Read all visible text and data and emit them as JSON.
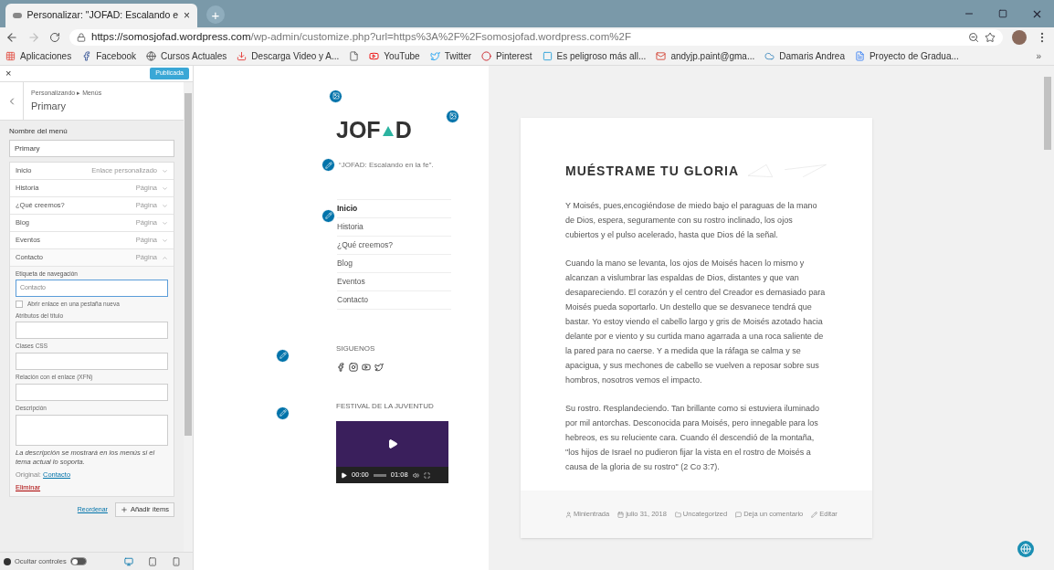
{
  "browser": {
    "tab": {
      "title": "Personalizar: \"JOFAD: Escalando e",
      "close": "×",
      "new_tab": "+"
    },
    "url": {
      "host": "https://somosjofad.wordpress.com",
      "path": "/wp-admin/customize.php?url=https%3A%2F%2Fsomosjofad.wordpress.com%2F"
    },
    "bookmarks": [
      {
        "kind": "apps",
        "label": "Aplicaciones"
      },
      {
        "kind": "facebook",
        "label": "Facebook"
      },
      {
        "kind": "globe",
        "label": "Cursos Actuales"
      },
      {
        "kind": "download",
        "label": "Descarga Video y A..."
      },
      {
        "kind": "page"
      },
      {
        "kind": "youtube",
        "label": "YouTube"
      },
      {
        "kind": "twitter",
        "label": "Twitter"
      },
      {
        "kind": "pinterest",
        "label": "Pinterest"
      },
      {
        "kind": "k",
        "label": "Es peligroso más all..."
      },
      {
        "kind": "gmail",
        "label": "andyjp.paint@gma..."
      },
      {
        "kind": "cloud",
        "label": "Damaris Andrea"
      },
      {
        "kind": "doc",
        "label": "Proyecto de Gradua..."
      }
    ],
    "more": "»"
  },
  "customizer": {
    "close": "×",
    "publish": "Publicada",
    "breadcrumb": "Personalizando ▸ Menús",
    "title": "Primary",
    "menu_name_label": "Nombre del menú",
    "menu_name": "Primary",
    "items": [
      {
        "label": "Inicio",
        "type": "Enlace personalizado",
        "expanded": false
      },
      {
        "label": "Historia",
        "type": "Página",
        "expanded": false
      },
      {
        "label": "¿Qué creemos?",
        "type": "Página",
        "expanded": false
      },
      {
        "label": "Blog",
        "type": "Página",
        "expanded": false
      },
      {
        "label": "Eventos",
        "type": "Página",
        "expanded": false
      },
      {
        "label": "Contacto",
        "type": "Página",
        "expanded": true
      }
    ],
    "nav_label": "Etiqueta de navegación",
    "nav_value": "Contacto",
    "new_tab": {
      "label": "Abrir enlace en una pestaña nueva",
      "checked": false
    },
    "fields": [
      {
        "label": "Atributos del título",
        "kind": "input"
      },
      {
        "label": "Clases CSS",
        "kind": "input"
      },
      {
        "label": "Relación con el enlace (XFN)",
        "kind": "input"
      },
      {
        "label": "Descripción",
        "kind": "textarea"
      }
    ],
    "note": "La descripción se mostrará en los menús si el tema actual lo soporta.",
    "original_label": "Original:",
    "original_link": "Contacto",
    "remove": "Eliminar",
    "reorder": "Reordenar",
    "add": "Añadir ítems",
    "hide_controls": {
      "label": "Ocultar controles",
      "on": false
    },
    "devices": [
      {
        "kind": "desktop",
        "selected": true
      },
      {
        "kind": "tablet",
        "selected": false
      },
      {
        "kind": "mobile",
        "selected": false
      }
    ]
  },
  "preview": {
    "logo": {
      "before": "JOF",
      "after": "D"
    },
    "tagline": "“JOFAD: Escalando en la fe”.",
    "nav": [
      {
        "label": "Inicio",
        "selected": true
      },
      {
        "label": "Historia",
        "selected": false
      },
      {
        "label": "¿Qué creemos?",
        "selected": false
      },
      {
        "label": "Blog",
        "selected": false
      },
      {
        "label": "Eventos",
        "selected": false
      },
      {
        "label": "Contacto",
        "selected": false
      }
    ],
    "follow_title": "SIGUENOS",
    "video_title": "FESTIVAL DE LA JUVENTUD",
    "video": {
      "start": "00:00",
      "end": "01:08"
    },
    "post": {
      "title": "MUÉSTRAME TU GLORIA",
      "paragraphs": [
        "Y Moisés, pues,encogiéndose de miedo bajo el paraguas de la mano de Dios, espera, seguramente con su rostro inclinado, los ojos cubiertos y el pulso acelerado, hasta que Dios dé la señal.",
        "Cuando la mano se levanta, los ojos de Moisés hacen lo mismo y alcanzan a vislumbrar las espaldas de Dios, distantes y que van desapareciendo. El corazón y el centro del Creador es demasiado para Moisés pueda soportarlo. Un destello que se desvanece tendrá que bastar. Yo estoy viendo el cabello largo  y gris de Moisés azotado hacia delante por e viento y su curtida mano agarrada a una roca saliente de la pared para no caerse. Y a medida que la ráfaga se calma y se apacigua, y sus mechones de cabello se vuelven a reposar sobre sus hombros, nosotros vemos el impacto.",
        "Su rostro. Resplandeciendo. Tan brillante como si estuviera iluminado por mil antorchas. Desconocida para Moisés, pero innegable para los hebreos, es su reluciente cara. Cuando él descendió de la montaña, \"los hijos de Israel no pudieron fijar la vista en el rostro de Moisés a causa de la gloria de su rostro\" (2 Co 3:7)."
      ],
      "meta": [
        {
          "kind": "author",
          "label": "Minientrada"
        },
        {
          "kind": "date",
          "label": "julio 31, 2018"
        },
        {
          "kind": "category",
          "label": "Uncategorized"
        },
        {
          "kind": "comment",
          "label": "Deja un comentario"
        },
        {
          "kind": "edit",
          "label": "Editar"
        }
      ]
    }
  }
}
